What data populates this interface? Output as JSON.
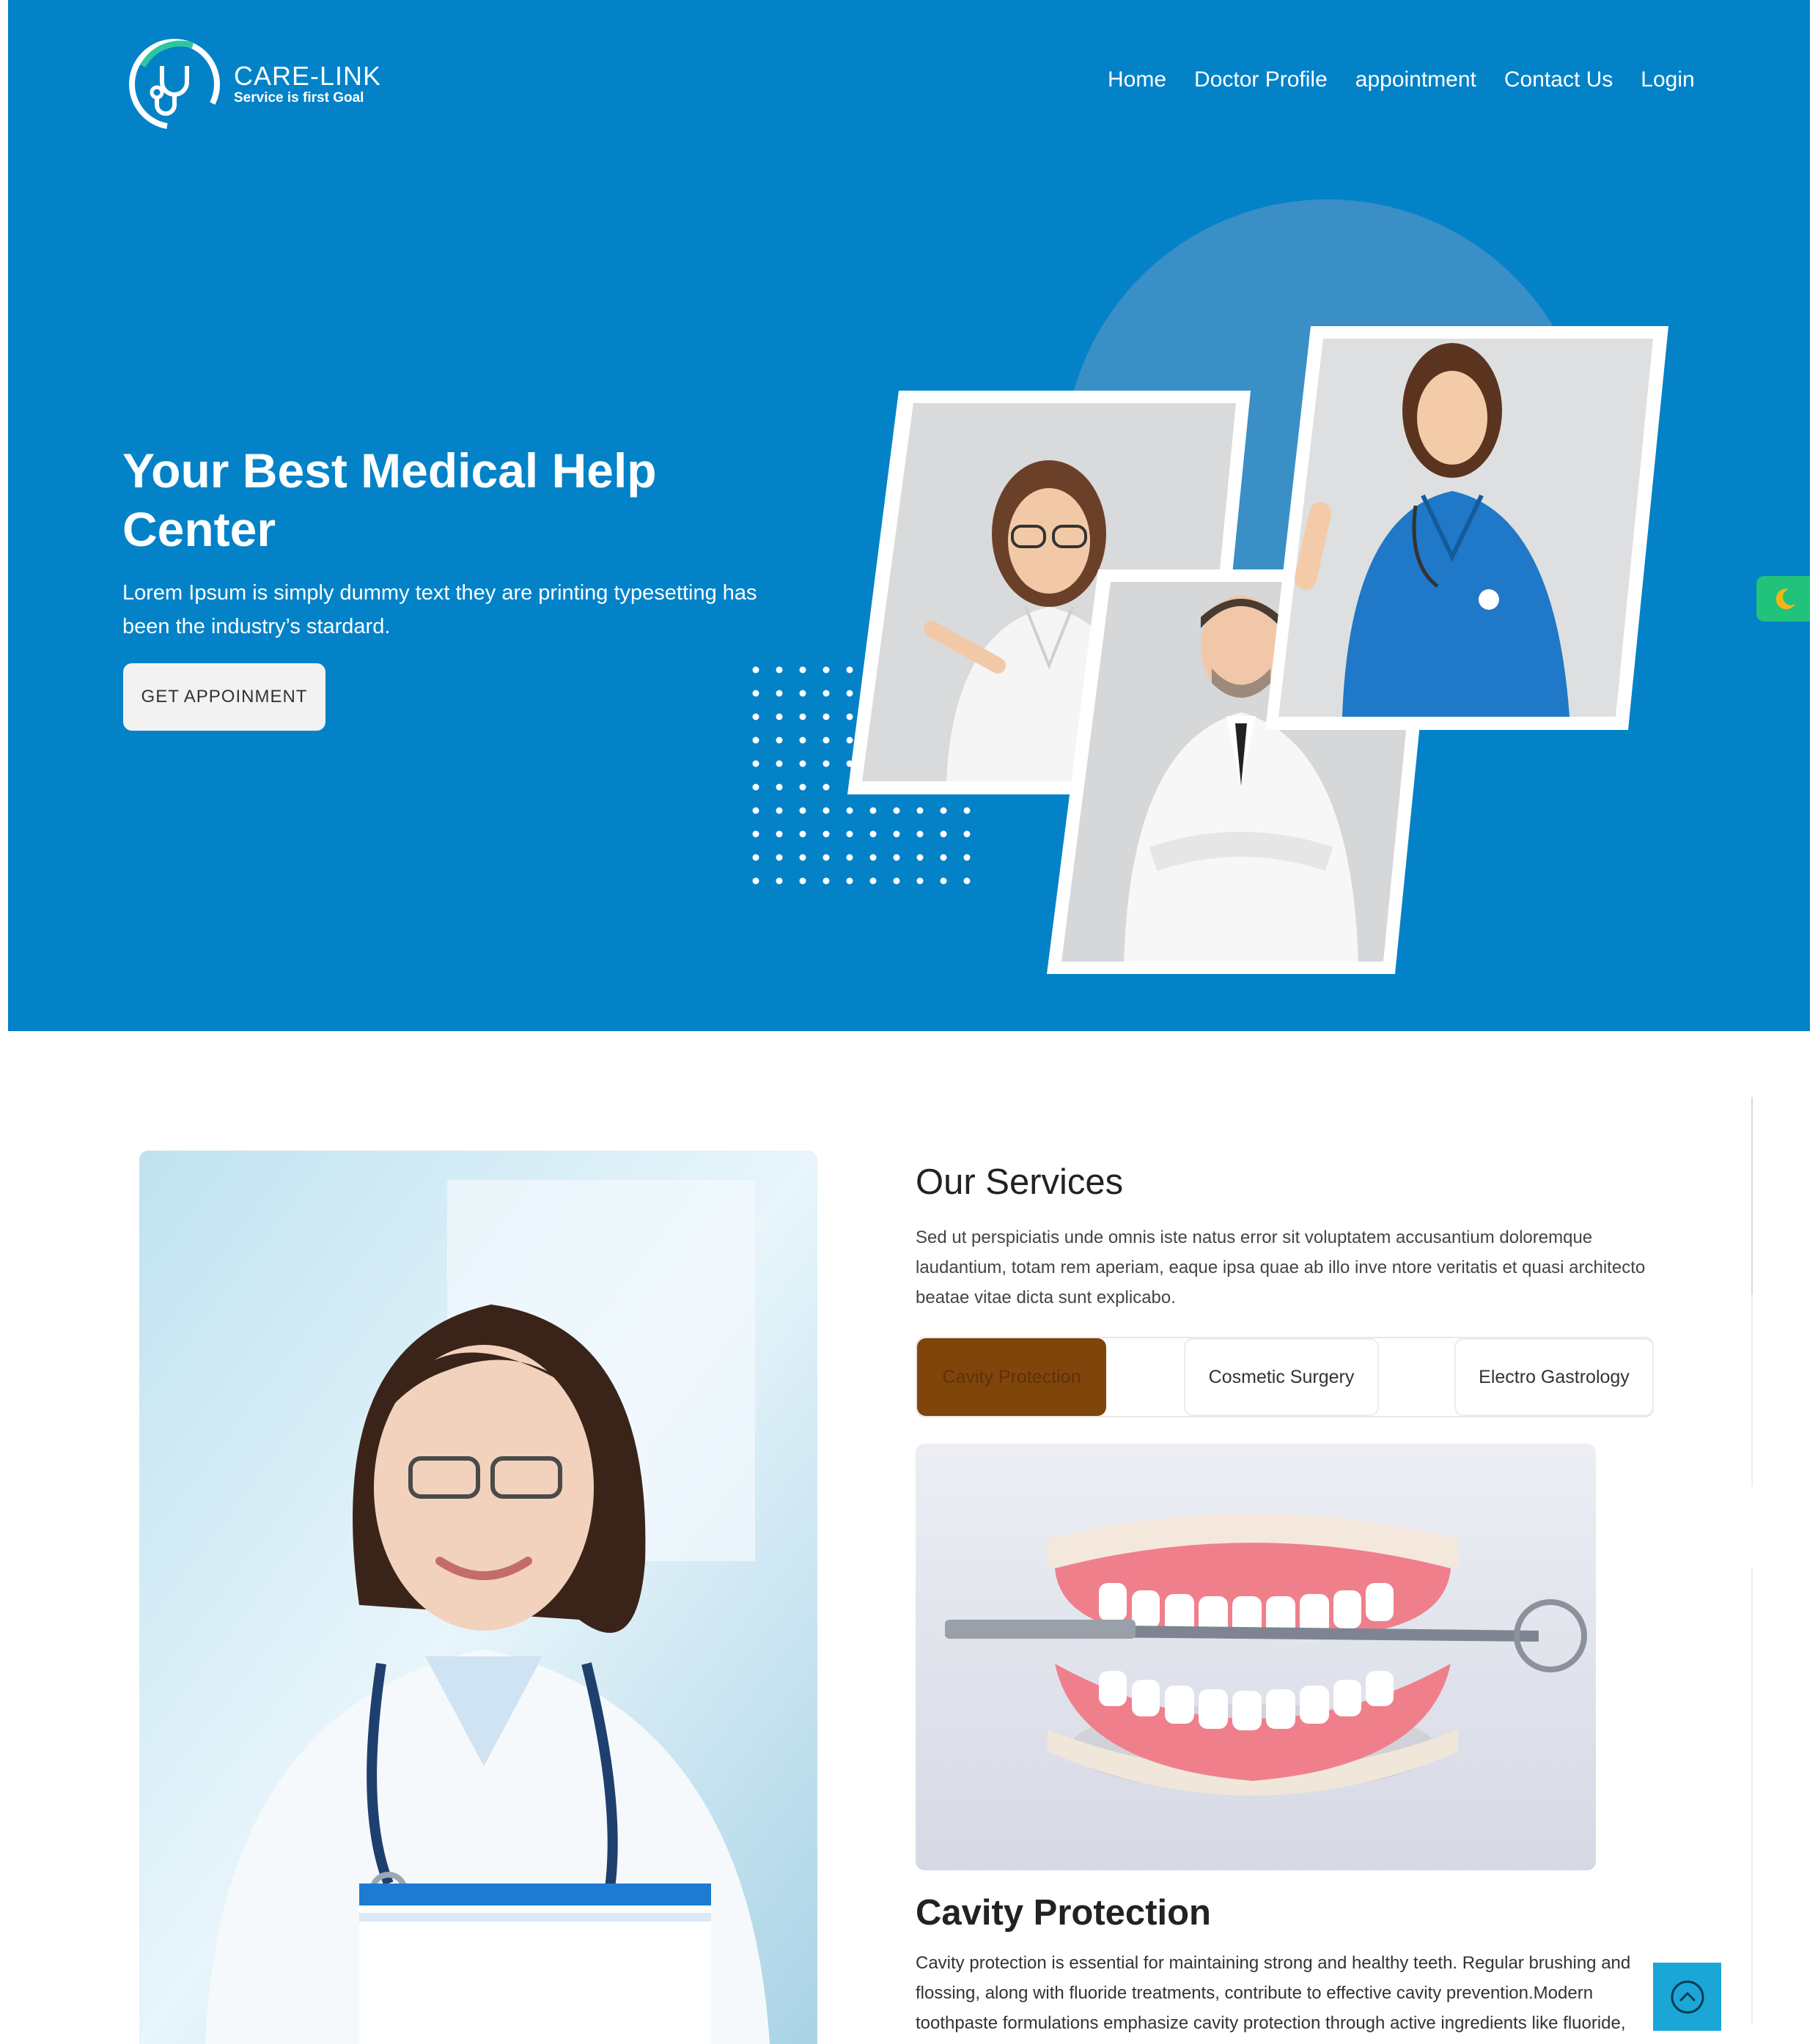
{
  "brand": {
    "name": "CARE-LINK",
    "tagline": "Service is first Goal"
  },
  "nav": {
    "items": [
      "Home",
      "Doctor Profile",
      "appointment",
      "Contact Us",
      "Login"
    ]
  },
  "hero": {
    "title": "Your Best Medical Help Center",
    "subtitle": "Lorem Ipsum is simply dummy text they are printing typesetting has been the industry’s stardard.",
    "cta_label": "GET APPOINMENT"
  },
  "services": {
    "title": "Our Services",
    "description": "Sed ut perspiciatis unde omnis iste natus error sit voluptatem accusantium doloremque laudantium, totam rem aperiam, eaque ipsa quae ab illo inve ntore veritatis et quasi architecto beatae vitae dicta sunt explicabo.",
    "tabs": [
      {
        "label": "Cavity Protection",
        "active": true
      },
      {
        "label": "Cosmetic Surgery",
        "active": false
      },
      {
        "label": "Electro Gastrology",
        "active": false
      }
    ],
    "detail_title": "Cavity Protection",
    "detail_text": "Cavity protection is essential for maintaining strong and healthy teeth. Regular brushing and flossing, along with fluoride treatments, contribute to effective cavity prevention.Modern toothpaste formulations emphasize cavity protection through active ingredients like fluoride, which strengthens enamel and helps prevent tooth decay. Dental"
  },
  "colors": {
    "hero_bg": "#0382c8",
    "active_tab": "#80450b",
    "toggle": "#21c27a",
    "scroll_top": "#1aa6d6"
  },
  "icons": {
    "logo": "stethoscope-icon",
    "theme_toggle": "moon-icon",
    "scroll_top": "chevron-up-icon"
  }
}
